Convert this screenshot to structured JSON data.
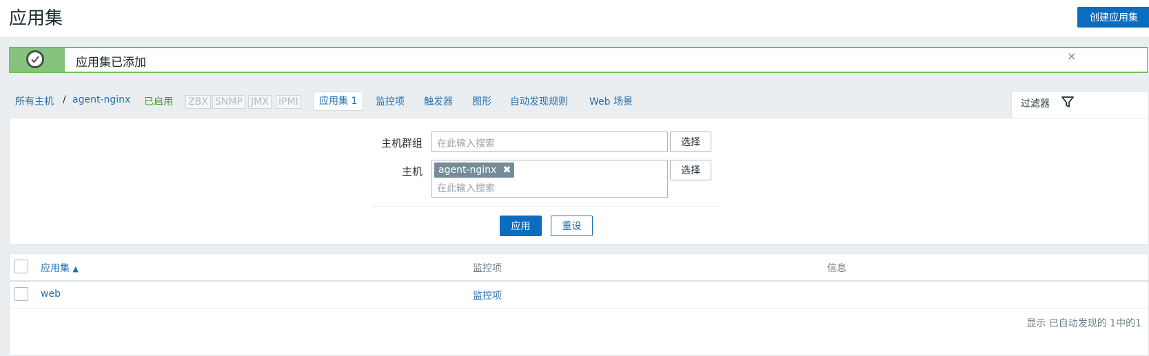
{
  "page": {
    "title": "应用集",
    "create_button": "创建应用集"
  },
  "message": {
    "text": "应用集已添加",
    "close": "×",
    "type": "success"
  },
  "nav": {
    "breadcrumb_all_hosts": "所有主机",
    "breadcrumb_sep": "/",
    "breadcrumb_host": "agent-nginx",
    "status": "已启用",
    "protocols": [
      "ZBX",
      "SNMP",
      "JMX",
      "IPMI"
    ],
    "tabs": [
      {
        "label": "应用集 1",
        "active": true
      },
      {
        "label": "监控项",
        "active": false
      },
      {
        "label": "触发器",
        "active": false
      },
      {
        "label": "图形",
        "active": false
      },
      {
        "label": "自动发现规则",
        "active": false
      },
      {
        "label": "Web 场景",
        "active": false
      }
    ],
    "filter_tab": "过滤器"
  },
  "filter": {
    "host_group_label": "主机群组",
    "host_group_placeholder": "在此输入搜索",
    "host_label": "主机",
    "host_chip": "agent-nginx",
    "host_chip_remove": "✖",
    "host_placeholder": "在此输入搜索",
    "select_label": "选择",
    "apply": "应用",
    "reset": "重设"
  },
  "table": {
    "columns": [
      {
        "label": "应用集",
        "sort": "▲"
      },
      {
        "label": "监控项"
      },
      {
        "label": "信息"
      }
    ],
    "rows": [
      {
        "application": "web",
        "items": "监控项",
        "info": ""
      }
    ],
    "footer": "显示 已自动发现的 1中的1"
  },
  "colors": {
    "primary": "#0b6dbf",
    "link": "#1f6fb0",
    "success": "#85c37e",
    "enabled_green": "#3f9a28"
  }
}
